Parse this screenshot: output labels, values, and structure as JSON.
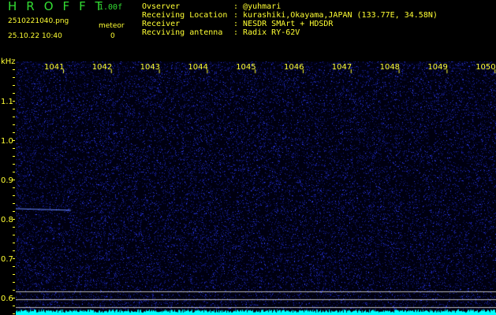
{
  "header": {
    "title": "HROFFT",
    "version": "1.00f",
    "filename": "2510221040.png",
    "datetime": "25.10.22 10:40",
    "meteor_label": "meteor",
    "meteor_count": "0"
  },
  "info": [
    {
      "label": "Ovserver",
      "value": "@yuhmari"
    },
    {
      "label": "Receiving Location",
      "value": "kurashiki,Okayama,JAPAN (133.77E, 34.58N)"
    },
    {
      "label": "Receiver",
      "value": "NESDR SMArt + HDSDR"
    },
    {
      "label": "Recviving antenna",
      "value": "Radix RY-62V"
    }
  ],
  "axis": {
    "unit": "kHz",
    "x_labels": [
      "1041",
      "1042",
      "1043",
      "1044",
      "1045",
      "1046",
      "1047",
      "1048",
      "1049",
      "1050"
    ],
    "y_labels": [
      "1.1",
      "1.0",
      "0.9",
      "0.8",
      "0.7",
      "0.6"
    ]
  },
  "colors": {
    "text": "#ffff33",
    "title": "#33dd33",
    "noise": "#2233cc",
    "level": "#00ffff"
  }
}
